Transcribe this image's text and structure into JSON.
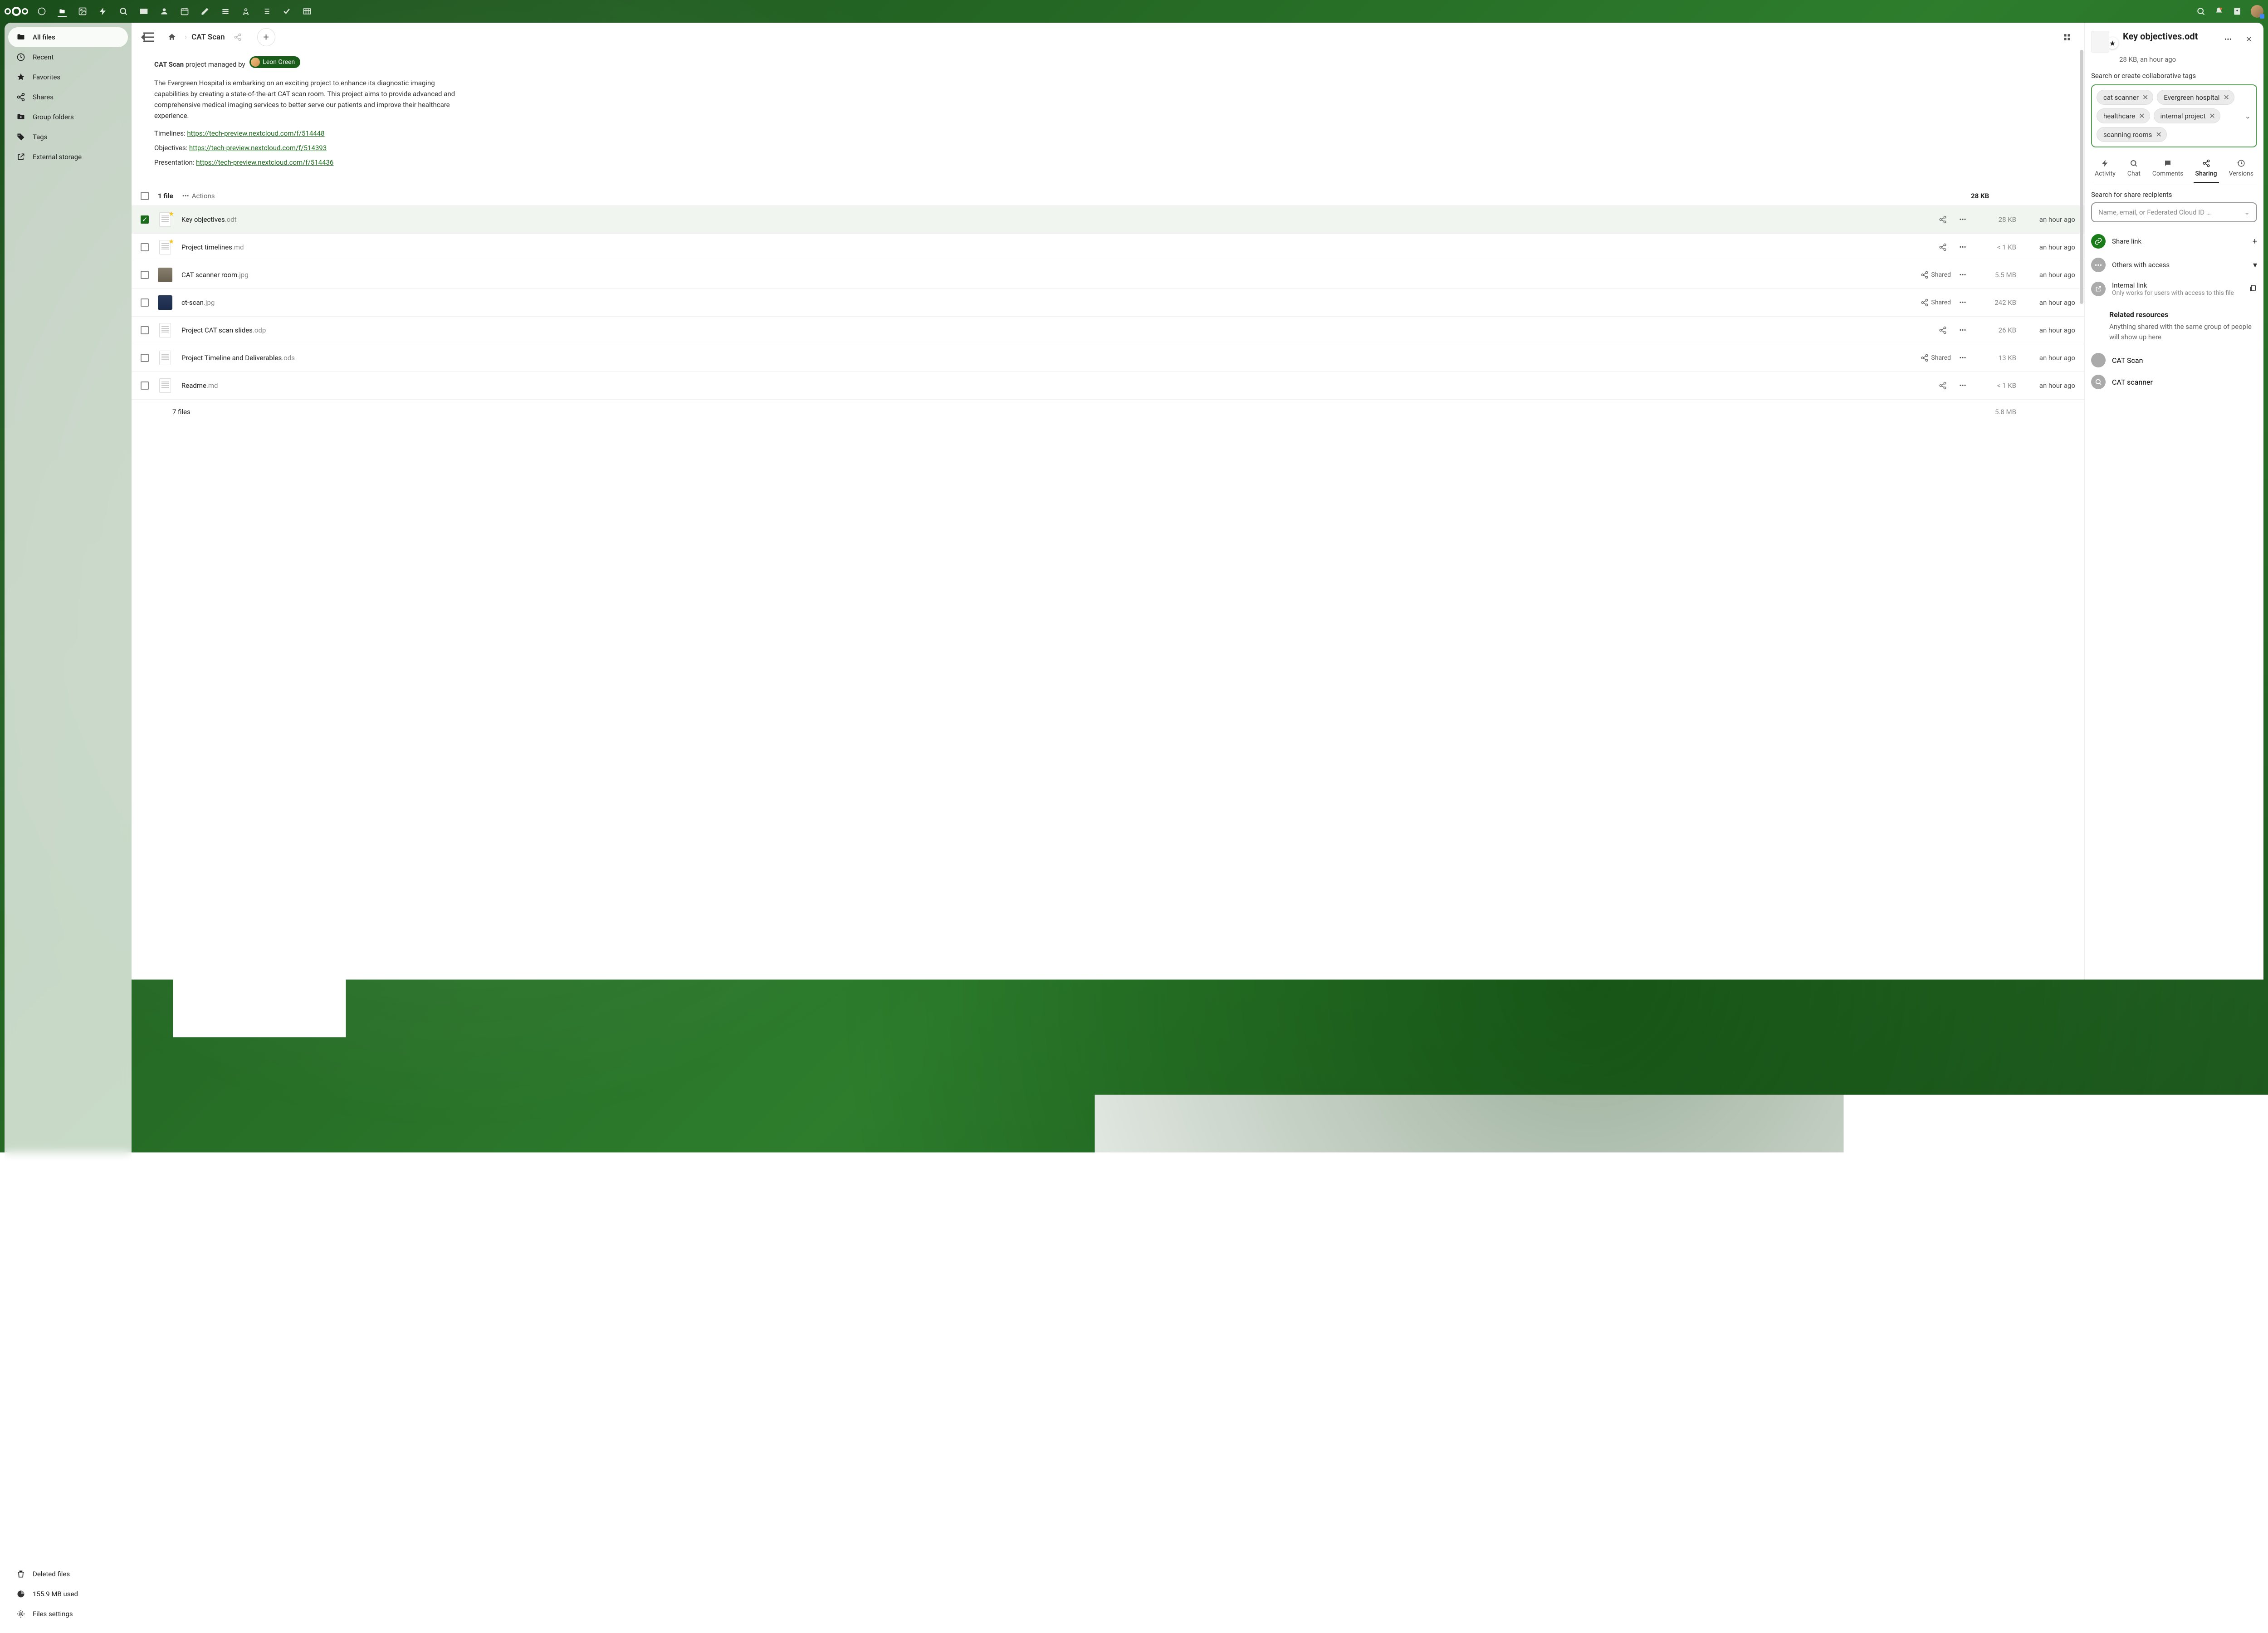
{
  "topNav": {
    "icons": [
      "dashboard",
      "files",
      "photos",
      "activity",
      "search-app",
      "mail",
      "contacts",
      "calendar",
      "notes",
      "deck",
      "bookmarks",
      "tasks-list",
      "tasks-check",
      "tables"
    ]
  },
  "sidebar": {
    "items": [
      {
        "icon": "folder",
        "label": "All files",
        "active": true
      },
      {
        "icon": "clock",
        "label": "Recent"
      },
      {
        "icon": "star",
        "label": "Favorites"
      },
      {
        "icon": "share",
        "label": "Shares"
      },
      {
        "icon": "group",
        "label": "Group folders"
      },
      {
        "icon": "tag",
        "label": "Tags"
      },
      {
        "icon": "external",
        "label": "External storage"
      }
    ],
    "bottom": {
      "deleted": "Deleted files",
      "quota": "155.9 MB used",
      "settings": "Files settings"
    }
  },
  "breadcrumb": {
    "current": "CAT Scan"
  },
  "project": {
    "name": "CAT Scan",
    "managedBy": "project managed by",
    "manager": "Leon Green",
    "description": "The Evergreen Hospital is embarking on an exciting project to enhance its diagnostic imaging capabilities by creating a state-of-the-art CAT scan room. This project aims to provide advanced and comprehensive medical imaging services to better serve our patients and improve their healthcare experience.",
    "links": [
      {
        "label": "Timelines: ",
        "url": "https://tech-preview.nextcloud.com/f/514448"
      },
      {
        "label": "Objectives: ",
        "url": "https://tech-preview.nextcloud.com/f/514393"
      },
      {
        "label": "Presentation: ",
        "url": "https://tech-preview.nextcloud.com/f/514436"
      }
    ]
  },
  "fileList": {
    "headerCount": "1 file",
    "actionsLabel": "Actions",
    "headerSize": "28 KB",
    "rows": [
      {
        "selected": true,
        "starred": true,
        "type": "doc",
        "name": "Key objectives",
        "ext": ".odt",
        "shared": false,
        "size": "28 KB",
        "time": "an hour ago"
      },
      {
        "selected": false,
        "starred": true,
        "type": "doc",
        "name": "Project timelines",
        "ext": ".md",
        "shared": false,
        "size": "< 1 KB",
        "time": "an hour ago"
      },
      {
        "selected": false,
        "starred": false,
        "type": "img",
        "name": "CAT scanner room",
        "ext": ".jpg",
        "shared": true,
        "sharedLabel": "Shared",
        "size": "5.5 MB",
        "time": "an hour ago"
      },
      {
        "selected": false,
        "starred": false,
        "type": "img2",
        "name": "ct-scan",
        "ext": ".jpg",
        "shared": true,
        "sharedLabel": "Shared",
        "size": "242 KB",
        "time": "an hour ago"
      },
      {
        "selected": false,
        "starred": false,
        "type": "doc",
        "name": "Project CAT scan slides",
        "ext": ".odp",
        "shared": false,
        "size": "26 KB",
        "time": "an hour ago"
      },
      {
        "selected": false,
        "starred": false,
        "type": "doc",
        "name": "Project Timeline and Deliverables",
        "ext": ".ods",
        "shared": true,
        "sharedLabel": "Shared",
        "size": "13 KB",
        "time": "an hour ago"
      },
      {
        "selected": false,
        "starred": false,
        "type": "doc",
        "name": "Readme",
        "ext": ".md",
        "shared": false,
        "size": "< 1 KB",
        "time": "an hour ago"
      }
    ],
    "summary": {
      "count": "7 files",
      "size": "5.8 MB"
    }
  },
  "details": {
    "title": "Key objectives.odt",
    "meta": "28 KB, an hour ago",
    "tagsLabel": "Search or create collaborative tags",
    "tags": [
      "cat scanner",
      "Evergreen hospital",
      "healthcare",
      "internal project",
      "scanning rooms"
    ],
    "tabs": [
      {
        "icon": "bolt",
        "label": "Activity"
      },
      {
        "icon": "chat",
        "label": "Chat"
      },
      {
        "icon": "comment",
        "label": "Comments"
      },
      {
        "icon": "share",
        "label": "Sharing",
        "active": true
      },
      {
        "icon": "history",
        "label": "Versions"
      }
    ],
    "searchLabel": "Search for share recipients",
    "searchPlaceholder": "Name, email, or Federated Cloud ID …",
    "shareLink": "Share link",
    "othersAccess": "Others with access",
    "internalLink": "Internal link",
    "internalLinkSub": "Only works for users with access to this file",
    "relatedTitle": "Related resources",
    "relatedDesc": "Anything shared with the same group of people will show up here",
    "relatedItems": [
      {
        "label": "CAT Scan"
      },
      {
        "label": "CAT scanner"
      }
    ]
  }
}
